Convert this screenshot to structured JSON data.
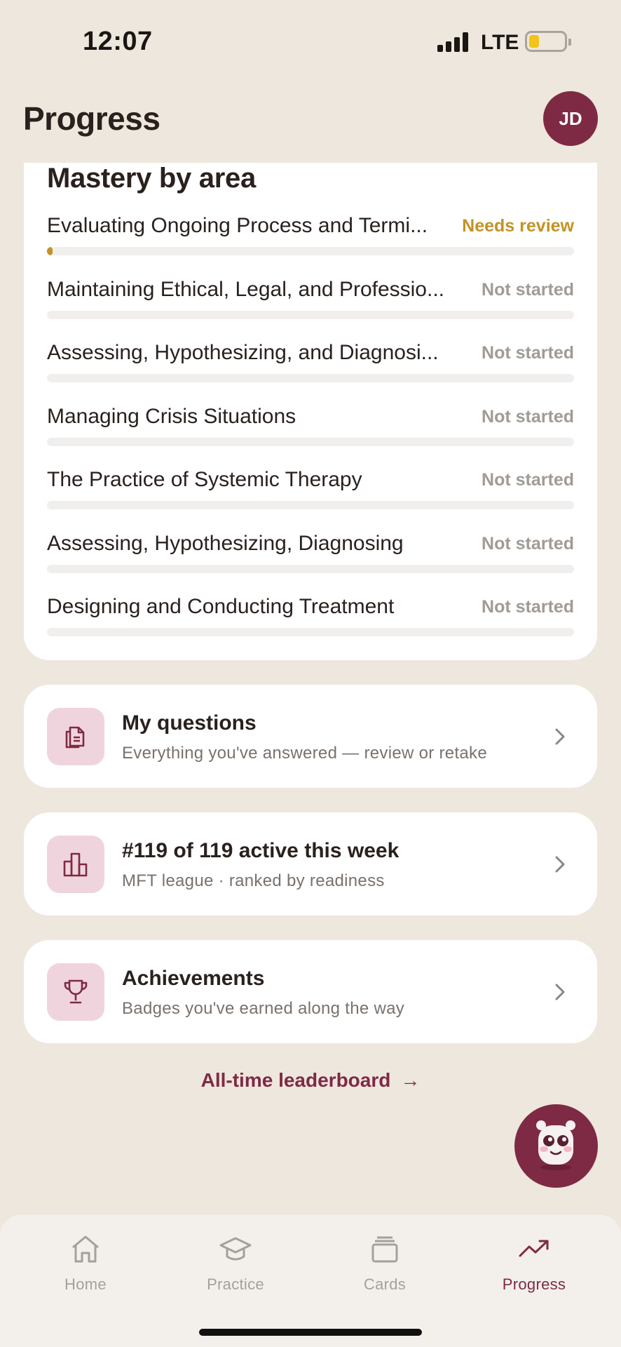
{
  "status_bar": {
    "time": "12:07",
    "network": "LTE",
    "battery_color": "#F2C318"
  },
  "header": {
    "title": "Progress",
    "avatar_initials": "JD"
  },
  "mastery": {
    "title": "Mastery by area",
    "items": [
      {
        "label": "Evaluating Ongoing Process and Termi...",
        "status": "Needs review",
        "progress": 0.01
      },
      {
        "label": "Maintaining Ethical, Legal, and Professio...",
        "status": "Not started",
        "progress": 0
      },
      {
        "label": "Assessing, Hypothesizing, and Diagnosi...",
        "status": "Not started",
        "progress": 0
      },
      {
        "label": "Managing Crisis Situations",
        "status": "Not started",
        "progress": 0
      },
      {
        "label": "The Practice of Systemic Therapy",
        "status": "Not started",
        "progress": 0
      },
      {
        "label": "Assessing, Hypothesizing, Diagnosing",
        "status": "Not started",
        "progress": 0
      },
      {
        "label": "Designing and Conducting Treatment",
        "status": "Not started",
        "progress": 0
      }
    ]
  },
  "cards": {
    "my_questions": {
      "title": "My questions",
      "subtitle": "Everything you've answered — review or retake",
      "icon": "documents-icon"
    },
    "league": {
      "title": "#119 of 119 active this week",
      "subtitle": "MFT league · ranked by readiness",
      "icon": "bar-chart-icon"
    },
    "achievements": {
      "title": "Achievements",
      "subtitle": "Badges you've earned along the way",
      "icon": "trophy-icon"
    }
  },
  "leaderboard_link": {
    "label": "All-time leaderboard",
    "arrow": "→"
  },
  "nav": {
    "items": [
      {
        "label": "Home",
        "icon": "home-icon"
      },
      {
        "label": "Practice",
        "icon": "graduation-cap-icon"
      },
      {
        "label": "Cards",
        "icon": "cards-icon"
      },
      {
        "label": "Progress",
        "icon": "trending-up-icon"
      }
    ],
    "active": "Progress"
  },
  "colors": {
    "accent": "#7E2A45",
    "review": "#C39322",
    "background": "#EEE7DD",
    "muted": "#A19B95"
  }
}
